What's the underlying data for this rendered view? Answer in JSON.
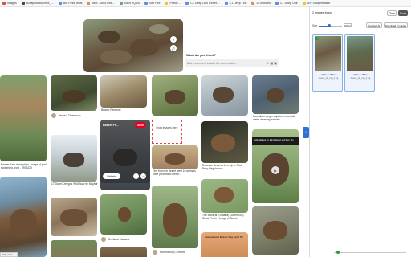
{
  "bookmarks": [
    {
      "label": "Images",
      "icon": "folder-icon",
      "color": "r"
    },
    {
      "label": "Acrapustation/RM_…",
      "icon": "site-icon",
      "color": "d"
    },
    {
      "label": "BM Fess Tests",
      "icon": "site-icon",
      "color": "b"
    },
    {
      "label": "Bexi - Juso Unit…",
      "icon": "site-icon",
      "color": "o"
    },
    {
      "label": "BM's eQMS",
      "icon": "site-icon",
      "color": "g"
    },
    {
      "label": "BM Flex",
      "icon": "site-icon",
      "color": "b"
    },
    {
      "label": "Profile…",
      "icon": "site-icon",
      "color": "y"
    },
    {
      "label": "C1 Deep Link Gener…",
      "icon": "site-icon",
      "color": "b"
    },
    {
      "label": "C1 Deep Link",
      "icon": "site-icon",
      "color": "b"
    },
    {
      "label": "30 Minutes",
      "icon": "site-icon",
      "color": "o"
    },
    {
      "label": "C1 Deep Unit",
      "icon": "site-icon",
      "color": "b"
    },
    {
      "label": "US/ Subgenerator",
      "icon": "folder-icon",
      "color": "y"
    }
  ],
  "hero": {
    "comment_prompt": "What do you think?",
    "comment_placeholder": "Add a comment to start the conversation"
  },
  "pins": {
    "bog_caption": "Beaver dam done photo. Image of pool, swimming, trout - 9973224",
    "top_user": "Jessica Thompson",
    "beaver_removal": "Beaver Removal",
    "hyena_caption": "17 Daem Designs Wild Boar by Mayfair",
    "eurasian_caption": "Eurasian Beavers Line Up In Their Busy Regulations",
    "tiny_caption": "Tiny from the desert west 10 animals once prevented dbfore…",
    "australia_caption": "Australian ranger captures mountain water dressing wallaby",
    "muskrat_caption": "The Muskrat (Ondatra) (Zibethicus) Stock Photo - Image of Beaver",
    "bottom_user_1": "Svetlana Tsatsura",
    "bottom_user_2": "Hummaking Cornsets",
    "news_banner": "Indianahaus zu Kampfsport auf dem Flo",
    "poster_text": "International Beaver Day April 7th",
    "hover_select": "Beaver Fo…",
    "hover_save": "Save",
    "hover_visit": "Visit site",
    "drop_label": "Drag images here"
  },
  "status_url": "https://pin…",
  "panel": {
    "header": "2 images found",
    "clear_label": "Clear",
    "close_label": "Close",
    "size_label": "Size",
    "size_value": "300px",
    "size_fraction": 0.42,
    "deselect_label": "Deselect All",
    "download_label": "Download 2 images",
    "thumbs": [
      {
        "dims": "736px × 488px",
        "name": "beaver_pin_img_1.jpg",
        "checked": true
      },
      {
        "dims": "736px × 488px",
        "name": "beaver_pin_img_2.jpg",
        "checked": false
      }
    ]
  },
  "accent": "#2f6fd6",
  "save_color": "#e60023"
}
